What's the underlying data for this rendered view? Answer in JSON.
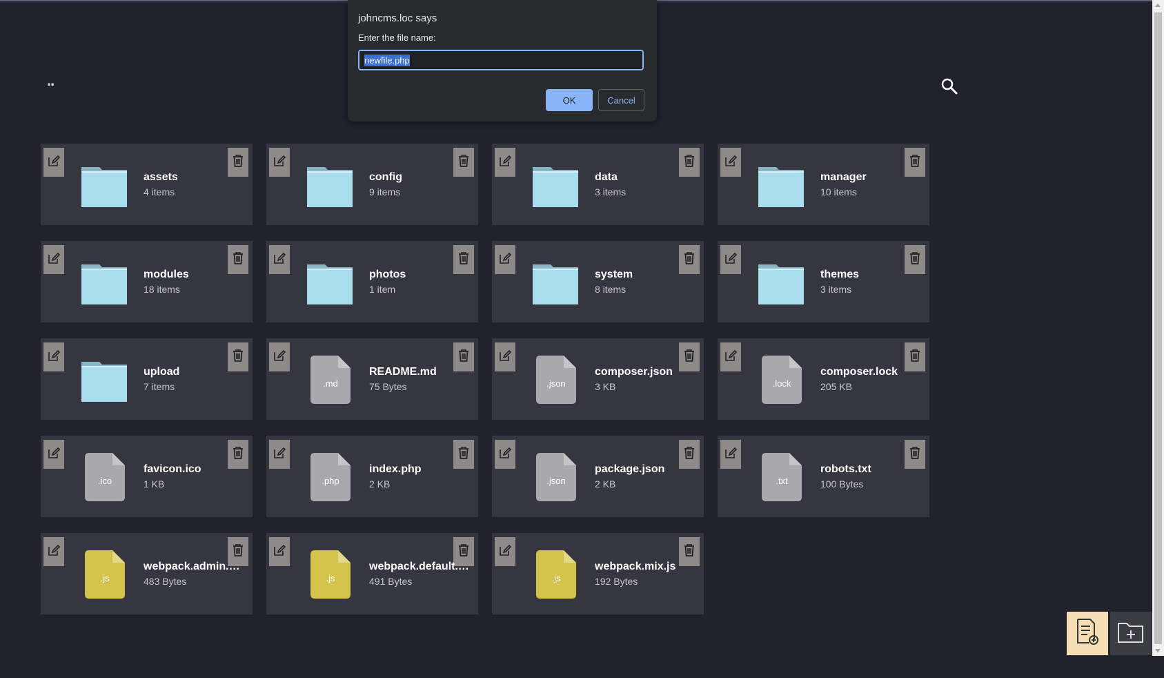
{
  "nav": {
    "up_label": ".."
  },
  "dialog": {
    "title": "johncms.loc says",
    "message": "Enter the file name:",
    "input_value": "newfile.php",
    "ok_label": "OK",
    "cancel_label": "Cancel"
  },
  "items": [
    {
      "type": "folder",
      "name": "assets",
      "meta": "4 items"
    },
    {
      "type": "folder",
      "name": "config",
      "meta": "9 items"
    },
    {
      "type": "folder",
      "name": "data",
      "meta": "3 items"
    },
    {
      "type": "folder",
      "name": "manager",
      "meta": "10 items"
    },
    {
      "type": "folder",
      "name": "modules",
      "meta": "18 items"
    },
    {
      "type": "folder",
      "name": "photos",
      "meta": "1 item"
    },
    {
      "type": "folder",
      "name": "system",
      "meta": "8 items"
    },
    {
      "type": "folder",
      "name": "themes",
      "meta": "3 items"
    },
    {
      "type": "folder",
      "name": "upload",
      "meta": "7 items"
    },
    {
      "type": "file",
      "ext": ".md",
      "name": "README.md",
      "meta": "75 Bytes"
    },
    {
      "type": "file",
      "ext": ".json",
      "name": "composer.json",
      "meta": "3 KB"
    },
    {
      "type": "file",
      "ext": ".lock",
      "name": "composer.lock",
      "meta": "205 KB"
    },
    {
      "type": "file",
      "ext": ".ico",
      "name": "favicon.ico",
      "meta": "1 KB"
    },
    {
      "type": "file",
      "ext": ".php",
      "name": "index.php",
      "meta": "2 KB"
    },
    {
      "type": "file",
      "ext": ".json",
      "name": "package.json",
      "meta": "2 KB"
    },
    {
      "type": "file",
      "ext": ".txt",
      "name": "robots.txt",
      "meta": "100 Bytes"
    },
    {
      "type": "file",
      "ext": ".js",
      "name": "webpack.admin.mix.js",
      "meta": "483 Bytes"
    },
    {
      "type": "file",
      "ext": ".js",
      "name": "webpack.default.mix.js",
      "meta": "491 Bytes"
    },
    {
      "type": "file",
      "ext": ".js",
      "name": "webpack.mix.js",
      "meta": "192 Bytes"
    }
  ],
  "colors": {
    "background": "#21222c",
    "card": "#35363f",
    "folder": "#a9dcec",
    "file_generic": "#a8a8ad",
    "file_js": "#d4c34a",
    "action_button": "#8e8a89",
    "accent": "#8ab4f8"
  },
  "icons": {
    "search": "search-icon",
    "edit": "edit-icon",
    "delete": "trash-icon",
    "new_file": "new-file-icon",
    "new_folder": "new-folder-icon"
  }
}
